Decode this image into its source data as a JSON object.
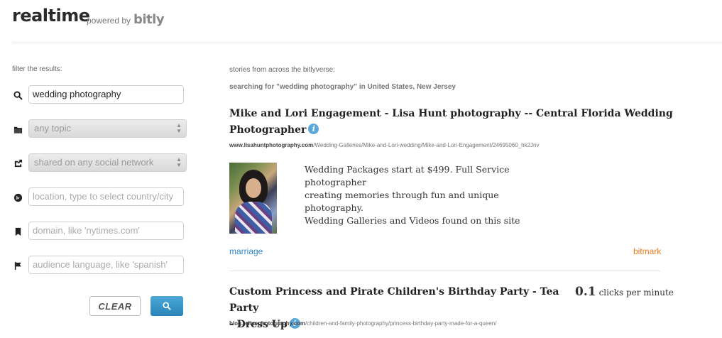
{
  "header": {
    "brand": "realtime",
    "powered_by": "powered by",
    "bitly": "bitly"
  },
  "filters": {
    "label": "filter the results:",
    "search": {
      "value": "wedding photography",
      "icon": "search-icon"
    },
    "topic": {
      "value": "any topic",
      "icon": "folder-icon"
    },
    "network": {
      "value": "shared on any social network",
      "icon": "share-icon"
    },
    "location": {
      "placeholder": "location, type to select country/city",
      "icon": "globe-icon"
    },
    "domain": {
      "placeholder": "domain, like 'nytimes.com'",
      "icon": "bookmark-icon"
    },
    "language": {
      "placeholder": "audience language, like 'spanish'",
      "icon": "flag-icon"
    },
    "clear_label": "CLEAR",
    "search_button_icon": "search-icon"
  },
  "results": {
    "heading": "stories from across the bitlyverse:",
    "searching_text": "searching for \"wedding photography\" in United States, New Jersey",
    "stories": [
      {
        "title_line1": "Mike and Lori Engagement - Lisa Hunt photography -- Central Florida Wedding",
        "title_line2": "Photographer",
        "url_domain": "www.lisahuntphotography.com",
        "url_path": "/Wedding-Galleries/Mike-and-Lori-wedding/Mike-and-Lori-Engagement/24695060_hk2Jnv",
        "description_line1": "Wedding Packages start at $499. Full Service photographer",
        "description_line2": "creating memories through fun and unique photography.",
        "description_line3": "Wedding Galleries and Videos found on this site",
        "tag": "marriage",
        "bitmark": "bitmark"
      },
      {
        "title_line1": "Custom Princess and Pirate Children's Birthday Party - Tea Party",
        "title_line2": "- Dress Up",
        "url_domain": "blog.relivephotography.com",
        "url_path": "/children-and-family-photography/princess-birthday-party-made-for-a-queen/",
        "clicks_value": "0.1",
        "clicks_label": "clicks per minute"
      }
    ]
  },
  "colors": {
    "accent_blue": "#2a84b8",
    "link_blue": "#2e87c4",
    "bitmark_orange": "#e87b1c",
    "info_blue": "#5aa7dc"
  }
}
